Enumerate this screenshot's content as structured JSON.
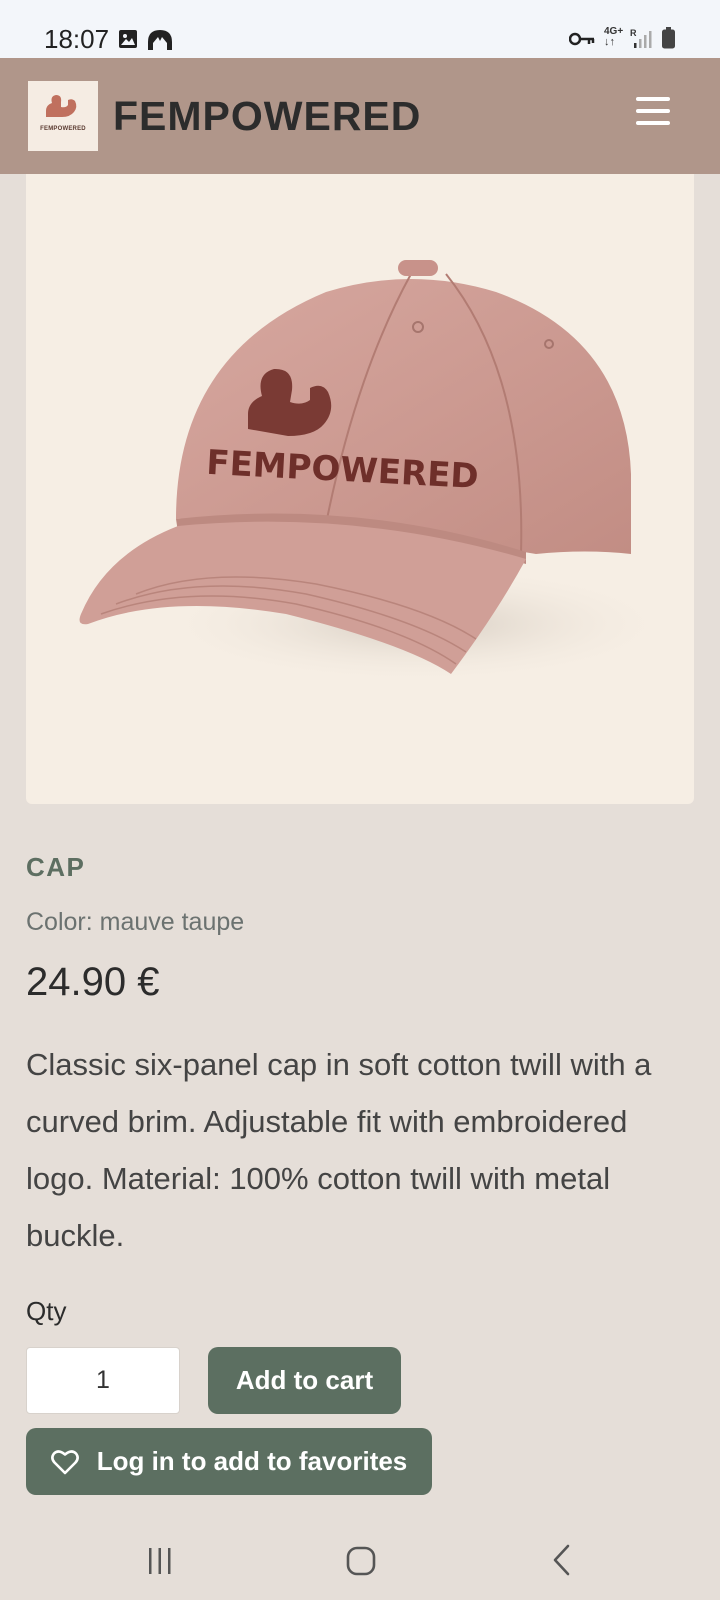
{
  "status_bar": {
    "time": "18:07",
    "network_label": "4G+",
    "roaming_label": "R",
    "icons": [
      "gallery-icon",
      "vpn-arch-icon",
      "key-icon",
      "network-arrows-icon",
      "signal-icon",
      "battery-icon"
    ]
  },
  "header": {
    "brand": "FEMPOWERED",
    "logo_text": "FEMPOWERED",
    "menu_icon": "hamburger-icon",
    "background_color": "#b0968a"
  },
  "product": {
    "image_logo_text": "FEMPOWERED",
    "name": "CAP",
    "color": "Color: mauve taupe",
    "price": "24.90 €",
    "description": "Classic six-panel cap in soft cotton twill with a curved brim. Adjustable fit with embroidered logo. Material: 100% cotton twill with metal buckle."
  },
  "purchase": {
    "qty_label": "Qty",
    "qty_value": "1",
    "add_to_cart_label": "Add to cart",
    "favorites_label": "Log in to add to favorites",
    "favorites_icon": "heart-icon",
    "button_color": "#5c6f61"
  },
  "system_nav": {
    "icons": [
      "recent-apps-icon",
      "home-icon",
      "back-icon"
    ]
  }
}
